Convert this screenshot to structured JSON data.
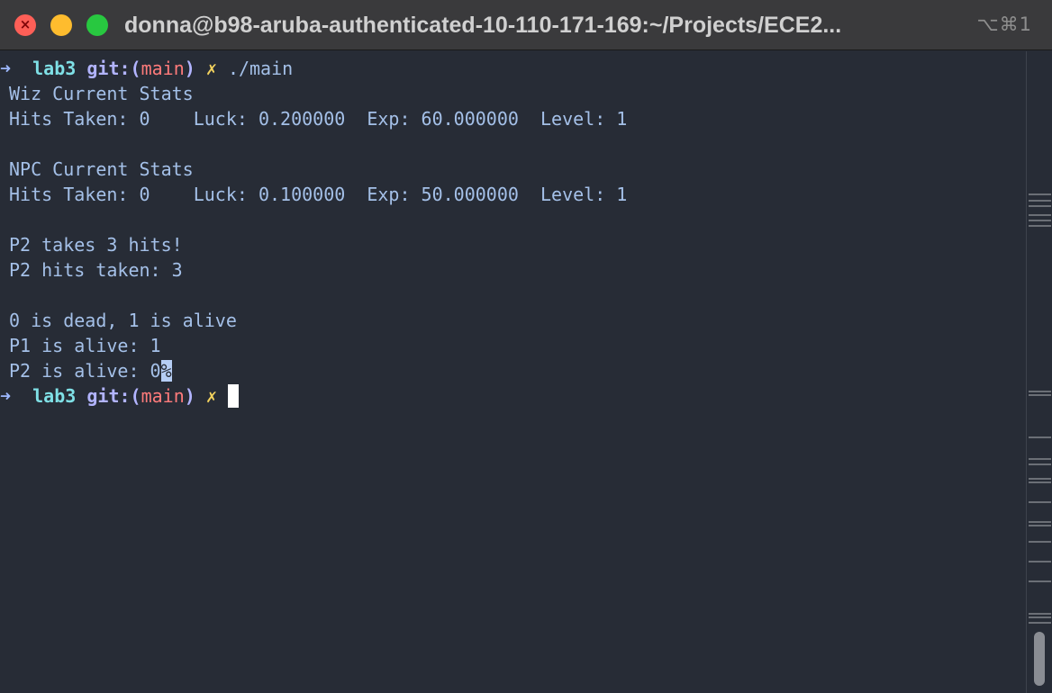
{
  "window": {
    "title": "donna@b98-aruba-authenticated-10-110-171-169:~/Projects/ECE2...",
    "shortcut": "⌥⌘1",
    "close_glyph": "×"
  },
  "prompt": {
    "arrow": "➜",
    "dir": "lab3",
    "git_prefix": "git:(",
    "branch": "main",
    "git_suffix": ")",
    "dirty": "✗"
  },
  "command": "./main",
  "output": {
    "line1": "Wiz Current Stats",
    "line2": "Hits Taken: 0    Luck: 0.200000  Exp: 60.000000  Level: 1",
    "line4": "NPC Current Stats",
    "line5": "Hits Taken: 0    Luck: 0.100000  Exp: 50.000000  Level: 1",
    "line7": "P2 takes 3 hits!",
    "line8": "P2 hits taken: 3",
    "line10": "0 is dead, 1 is alive",
    "line11": "P1 is alive: 1",
    "line12_text": "P2 is alive: 0",
    "line12_marker": "%"
  },
  "colors": {
    "background": "#272c36",
    "titlebar": "#3a3a3c",
    "text": "#a4c0e8",
    "branch": "#ff7b7b",
    "dirty": "#f4d35e",
    "dir": "#7fe0e6"
  },
  "icons": {
    "close": "close-icon",
    "minimize": "minimize-icon",
    "zoom": "zoom-icon"
  }
}
